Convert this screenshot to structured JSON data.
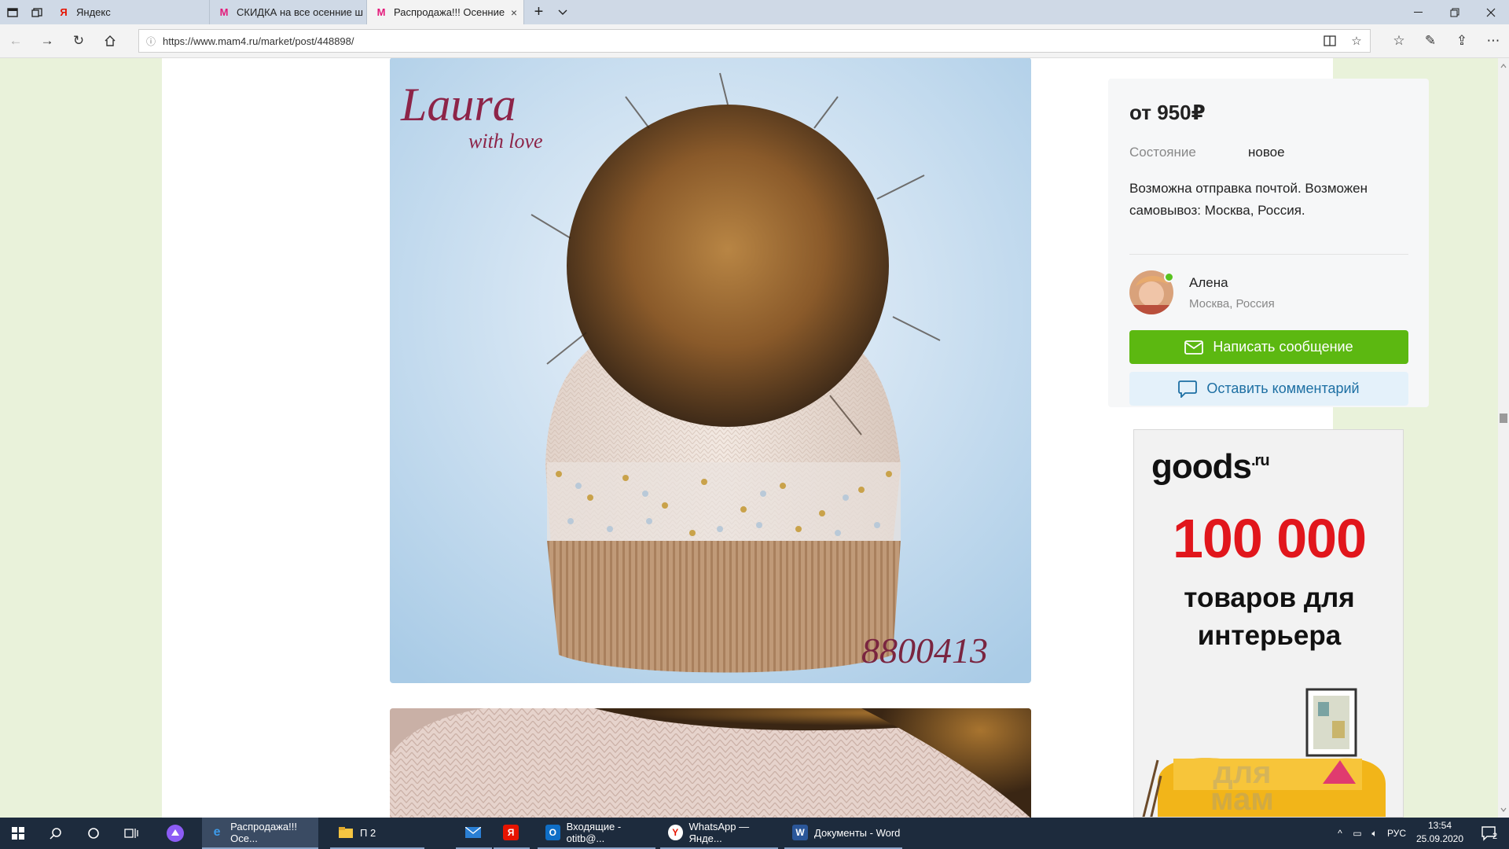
{
  "browser": {
    "tabs": [
      {
        "title": "Яндекс",
        "favicon": "yandex-icon",
        "active": false
      },
      {
        "title": "СКИДКА на все осенние ш",
        "favicon": "mam4-icon",
        "active": false
      },
      {
        "title": "Распродажа!!! Осенние",
        "favicon": "mam4-icon",
        "active": true
      }
    ],
    "url": "https://www.mam4.ru/market/post/448898/",
    "close_tab": "×"
  },
  "listing": {
    "price": "от 950₽",
    "condition_label": "Состояние",
    "condition_value": "новое",
    "delivery": "Возможна отправка почтой. Возможен самовывоз: Москва, Россия.",
    "seller": {
      "name": "Алена",
      "location": "Москва, Россия",
      "online": true
    },
    "write_message": "Написать сообщение",
    "leave_comment": "Оставить комментарий"
  },
  "photo": {
    "brand_logo": "Laura",
    "brand_tagline": "with love",
    "article": "8800413"
  },
  "ad": {
    "brand": "goods",
    "brand_suffix": ".ru",
    "number": "100 000",
    "text_line1": "товаров для",
    "text_line2": "интерьера"
  },
  "watermark": {
    "line1": "для",
    "line2": "мам"
  },
  "taskbar": {
    "apps": [
      {
        "label": "Распродажа!!! Осе...",
        "icon": "edge-icon",
        "active": true
      },
      {
        "label": "П 2",
        "icon": "folder-icon",
        "active": false
      },
      {
        "label": "",
        "icon": "mail-icon",
        "active": false
      },
      {
        "label": "",
        "icon": "yandex-browser-icon",
        "active": false
      },
      {
        "label": "Входящие - otitb@...",
        "icon": "outlook-icon",
        "active": false
      },
      {
        "label": "WhatsApp — Янде...",
        "icon": "yandex-icon",
        "active": false
      },
      {
        "label": "Документы - Word",
        "icon": "word-icon",
        "active": false
      }
    ],
    "language": "РУС",
    "time": "13:54",
    "date": "25.09.2020",
    "notifications": "2"
  },
  "colors": {
    "accent_green": "#5cb811",
    "comment_button_bg": "#e4f1fa",
    "comment_button_text": "#1d6fa3",
    "ad_red": "#e1161c",
    "page_bg": "#e9f2da"
  }
}
